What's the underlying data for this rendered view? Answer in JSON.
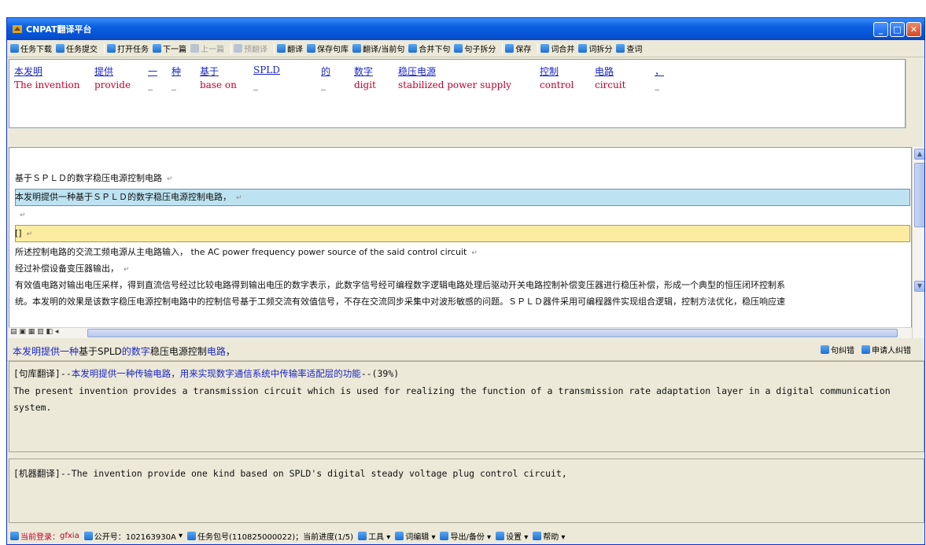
{
  "window": {
    "title": "CNPAT翻译平台"
  },
  "toolbar": [
    {
      "label": "任务下载"
    },
    {
      "label": "任务提交"
    },
    {
      "sep": true
    },
    {
      "label": "打开任务"
    },
    {
      "label": "下一篇"
    },
    {
      "label": "上一篇",
      "disabled": true
    },
    {
      "sep": true
    },
    {
      "label": "预翻译",
      "disabled": true
    },
    {
      "sep": true
    },
    {
      "label": "翻译"
    },
    {
      "label": "保存句库"
    },
    {
      "label": "翻译/当前句"
    },
    {
      "label": "合并下句"
    },
    {
      "label": "句子拆分"
    },
    {
      "sep": true
    },
    {
      "label": "保存"
    },
    {
      "sep": true
    },
    {
      "label": "词合并"
    },
    {
      "label": "词拆分"
    },
    {
      "label": "查词"
    }
  ],
  "alignment": {
    "source": [
      "本发明",
      "提供",
      "一",
      "种",
      "基于",
      "SPLD",
      "的",
      "数字",
      "稳压电源",
      "控制",
      "电路",
      "，"
    ],
    "target": [
      "The invention",
      "provide",
      "_",
      "_",
      "base on",
      "_",
      "_",
      "digit",
      "stabilized power supply",
      "control",
      "circuit",
      "_"
    ]
  },
  "document": {
    "lines": [
      "基于ＳＰＬＤ的数字稳压电源控制电路",
      "本发明提供一种基于ＳＰＬＤ的数字稳压电源控制电路，",
      "",
      "[]",
      "所述控制电路的交流工频电源从主电路输入，  the AC power frequency power source of the said control circuit",
      "经过补偿设备变压器输出，",
      "有效值电路对输出电压采样，得到直流信号经过比较电路得到输出电压的数字表示，此数字信号经可编程数字逻辑电路处理后驱动开关电路控制补偿变压器进行稳压补偿，形成一个典型的恒压闭环控制系",
      "统。本发明的效果是该数字稳压电源控制电路中的控制信号基于工频交流有效值信号，不存在交流同步采集中对波形敏感的问题。ＳＰＬＤ器件采用可编程器件实现组合逻辑，控制方法优化，稳压响应速"
    ]
  },
  "current_sentence": {
    "parts": [
      "本发明提供一种",
      "基于SPLD",
      "的数字",
      "稳压电源控制",
      "电路",
      "，"
    ]
  },
  "right_buttons": [
    "句纠错",
    "申请人纠错"
  ],
  "memory": {
    "tag": "[句库翻译]--",
    "source": "本发明提供一种传输电路，用来实现数字通信系统中传输率适配层的功能",
    "score": "--(39%)",
    "translation": "The present invention provides a transmission circuit which is used for realizing the function of a transmission rate adaptation layer in a digital communication system."
  },
  "machine": {
    "text": "[机器翻译]--The invention provide one kind based on SPLD's digital steady voltage plug control circuit,"
  },
  "statusbar": {
    "login_label": "当前登录：",
    "login_user": "gfxia",
    "pub_label": "公开号：102163930A",
    "task_label": "任务包号(110825000022)；当前进度(1/5)",
    "items": [
      "工具",
      "词编辑",
      "导出/备份",
      "设置",
      "帮助"
    ]
  },
  "colors": {
    "titlebar": "#0a5ee0",
    "source_link": "#1b26c6",
    "target_red": "#c0002c",
    "current_band": "#bde3f2",
    "edit_band": "#fbeca0"
  }
}
